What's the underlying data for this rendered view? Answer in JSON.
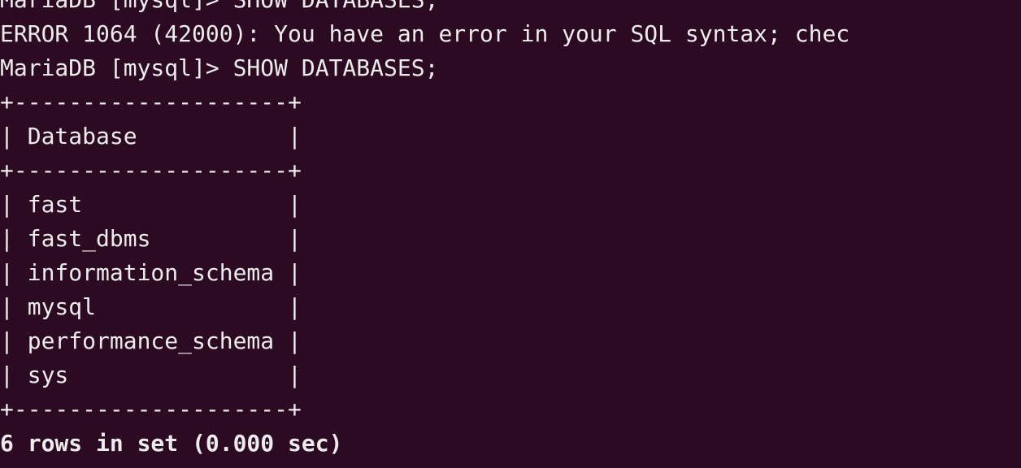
{
  "terminal": {
    "background": "#2c0a22",
    "foreground": "#ececec",
    "lines": [
      "MariaDB [mysql]> SHOW DATABASES;",
      "ERROR 1064 (42000): You have an error in your SQL syntax; chec",
      "MariaDB [mysql]> SHOW DATABASES;",
      "+--------------------+",
      "| Database           |",
      "+--------------------+",
      "| fast               |",
      "| fast_dbms          |",
      "| information_schema |",
      "| mysql              |",
      "| performance_schema |",
      "| sys                |",
      "+--------------------+",
      "6 rows in set (0.000 sec)"
    ]
  }
}
